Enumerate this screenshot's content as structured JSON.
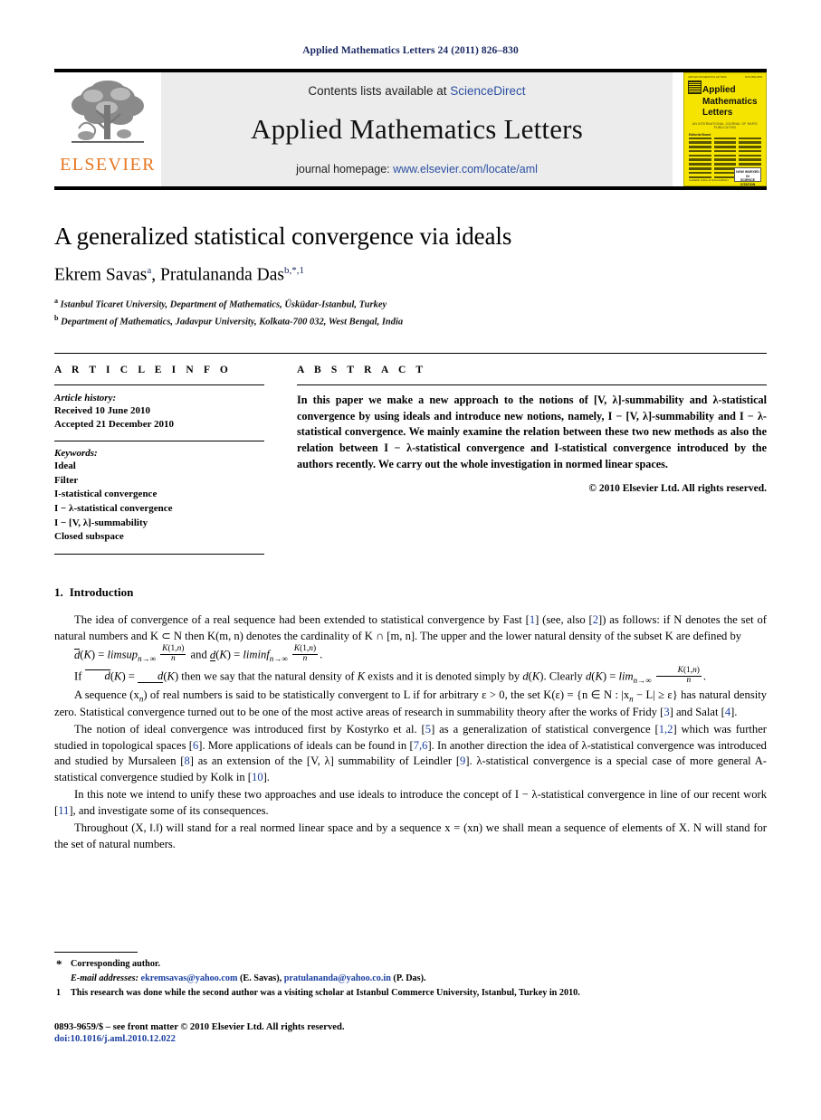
{
  "running_head": "Applied Mathematics Letters 24 (2011) 826–830",
  "masthead": {
    "publisher_name": "ELSEVIER",
    "contents_prefix": "Contents lists available at",
    "contents_link": "ScienceDirect",
    "journal_title": "Applied Mathematics Letters",
    "homepage_prefix": "journal homepage:",
    "homepage_url": "www.elsevier.com/locate/aml",
    "cover": {
      "title_line1": "Applied",
      "title_line2": "Mathematics",
      "title_line3": "Letters",
      "subtitle": "AN INTERNATIONAL JOURNAL OF RAPID PUBLICATION",
      "editorial_board": "Editorial Board",
      "top_left": "APPLIED MATHEMATICS LETTERS",
      "top_right": "ISSN 0893-9659",
      "sciencedirect": "Available online at\nScienceDirect",
      "stamp_line1": "NOW INDEXED IN",
      "stamp_line2": "SCIENCE CITATION"
    }
  },
  "article": {
    "title": "A generalized statistical convergence via ideals",
    "authors": [
      {
        "name": "Ekrem Savas",
        "marks": "a"
      },
      {
        "name": "Pratulananda Das",
        "marks": "b,*,1"
      }
    ],
    "affiliations": [
      {
        "mark": "a",
        "text": "Istanbul Ticaret University, Department of Mathematics, Üsküdar-Istanbul, Turkey"
      },
      {
        "mark": "b",
        "text": "Department of Mathematics, Jadavpur University, Kolkata-700 032, West Bengal, India"
      }
    ]
  },
  "info": {
    "heading": "A R T I C L E   I N F O",
    "history_label": "Article history:",
    "history": [
      "Received 10 June 2010",
      "Accepted 21 December 2010"
    ],
    "keywords_label": "Keywords:",
    "keywords": [
      "Ideal",
      "Filter",
      "I-statistical convergence",
      "I − λ-statistical convergence",
      "I − [V, λ]-summability",
      "Closed subspace"
    ]
  },
  "abstract": {
    "heading": "A B S T R A C T",
    "text": "In this paper we make a new approach to the notions of [V, λ]-summability and λ-statistical convergence by using ideals and introduce new notions, namely, I − [V, λ]-summability and I − λ-statistical convergence. We mainly examine the relation between these two new methods as also the relation between I − λ-statistical convergence and I-statistical convergence introduced by the authors recently. We carry out the whole investigation in normed linear spaces.",
    "copyright": "© 2010 Elsevier Ltd. All rights reserved."
  },
  "body": {
    "section_number": "1.",
    "section_title": "Introduction",
    "p1_a": "The idea of convergence of a real sequence had been extended to statistical convergence by Fast [",
    "p1_r1": "1",
    "p1_b": "] (see, also [",
    "p1_r2": "2",
    "p1_c": "]) as follows: if N denotes the set of natural numbers and K ⊂ N then K(m, n) denotes the cardinality of K ∩ [m, n]. The upper and the lower natural density of the subset K are defined by",
    "eq1": "d̄(K) = limsup n→∞ K(1,n)/n and d(K) = liminf n→∞ K(1,n)/n.",
    "p2": "If d̄(K) = d(K) then we say that the natural density of K exists and it is denoted simply by d(K). Clearly d(K) = lim n→∞ K(1,n)/n.",
    "p3_a": "A sequence (x",
    "p3_b": ") of real numbers is said to be statistically convergent to L if for arbitrary ε > 0, the set K(ε) = {n ∈ N : |x",
    "p3_c": " − L| ≥ ε} has natural density zero. Statistical convergence turned out to be one of the most active areas of research in summability theory after the works of Fridy [",
    "p3_r1": "3",
    "p3_d": "] and Salat [",
    "p3_r2": "4",
    "p3_e": "].",
    "p4_a": "The notion of ideal convergence was introduced first by Kostyrko et al. [",
    "p4_r1": "5",
    "p4_b": "] as a generalization of statistical convergence [",
    "p4_r2": "1,2",
    "p4_c": "] which was further studied in topological spaces [",
    "p4_r3": "6",
    "p4_d": "]. More applications of ideals can be found in [",
    "p4_r4": "7,6",
    "p4_e": "]. In another direction the idea of λ-statistical convergence was introduced and studied by Mursaleen [",
    "p4_r5": "8",
    "p4_f": "] as an extension of the [V, λ] summability of Leindler [",
    "p4_r6": "9",
    "p4_g": "]. λ-statistical convergence is a special case of more general A-statistical convergence studied by Kolk in [",
    "p4_r7": "10",
    "p4_h": "].",
    "p5_a": "In this note we intend to unify these two approaches and use ideals to introduce the concept of I − λ-statistical convergence in line of our recent work [",
    "p5_r1": "11",
    "p5_b": "], and investigate some of its consequences.",
    "p6": "Throughout (X, ‖.‖) will stand for a real normed linear space and by a sequence x = (xn) we shall mean a sequence of elements of X. N will stand for the set of natural numbers."
  },
  "footnotes": {
    "corresponding_marker": "*",
    "corresponding_text": "Corresponding author.",
    "email_label": "E-mail addresses:",
    "email1": "ekremsavas@yahoo.com",
    "email1_author": "(E. Savas),",
    "email2": "pratulananda@yahoo.co.in",
    "email2_author": "(P. Das).",
    "note_marker": "1",
    "note_text": "This research was done while the second author was a visiting scholar at Istanbul Commerce University, Istanbul, Turkey in 2010."
  },
  "footer": {
    "issn_line": "0893-9659/$ – see front matter © 2010 Elsevier Ltd. All rights reserved.",
    "doi_line": "doi:10.1016/j.aml.2010.12.022"
  },
  "colors": {
    "link": "#1b3fa0",
    "running_head": "#1b2a63",
    "elsevier_orange": "#e87722",
    "cover_yellow": "#f5e400",
    "masthead_gray": "#ececec"
  }
}
